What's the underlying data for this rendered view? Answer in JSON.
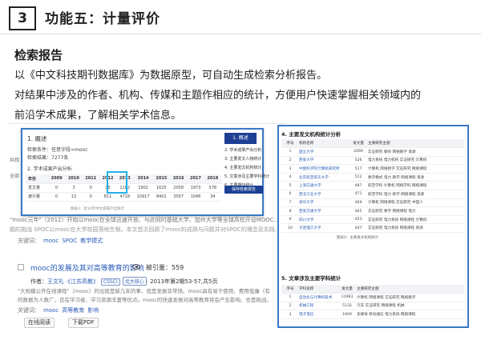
{
  "header": {
    "number": "3",
    "title": "功能五：计量评价"
  },
  "section": {
    "title": "检索报告",
    "lines": [
      "以《中文科技期刊数据库》为数据原型，可自动生成检索分析报告。",
      "对结果中涉及的作者、机构、传媒和主题作相应的统计，方便用户快速掌握相关领域内的",
      "前沿学术成果，了解相关学术信息。"
    ]
  },
  "bg_results": {
    "left_fragments": [
      "共找",
      "全部"
    ],
    "rows": [
      "\"mooc元年\"（2012）开始以mooc在全球迅速开放、与此同时基础大学、加州大学等全球高校开设MOOC...",
      "题的挑战 SPOC以mooc在大学校园落地生根。本文首次回顾了mooc的成熟与问题并对SPOC的理念及实践..."
    ],
    "keywords_label": "关键词：",
    "keywords": [
      "mooc",
      "SPOC",
      "教学模式"
    ]
  },
  "doc": {
    "title": "mooc的发展及其对高等教育的影响",
    "cited_label": "被引量：559",
    "authors_label": "作者：",
    "authors": "王文礼 ·《江苏高教》",
    "badges": [
      "CSSCI",
      "北大核心"
    ],
    "issue": "· 2013年第2期53-57,共5页",
    "abstract1": "\"大规模公开在线课程\"（mooc）的出现是新几年的事，但是发展非常快。mooc具有易于使用、费用低廉（有",
    "abstract2": "的数据为人数广，且在学习者、学习资源丰富等优点。mooc的快速发展对高等教育将会产生影响、也是挑战。",
    "keywords_label": "关键词：",
    "keywords": [
      "mooc",
      "高等教育",
      "影响"
    ],
    "read_button": "在线阅读",
    "pdf_button": "下载PDF"
  },
  "modal": {
    "overview_label": "1. 概述",
    "query_label": "检索条件：",
    "query_value": "任意字段=mooc",
    "count_label": "检索结果：",
    "count_value": "7277条",
    "side_title": "1. 概述",
    "side_items": [
      "2. 学术成果产出分析",
      "3. 主要发文人物统计",
      "4. 主要发文机构统计",
      "5. 文章涉及主要学科统计",
      "6. 主要期刊统计"
    ],
    "generate_button": "保存检索报告",
    "section2_label": "2. 学术成果产出分析",
    "years": [
      "年份",
      "2009",
      "2010",
      "2011",
      "2012",
      "2013",
      "2014",
      "2015",
      "2016",
      "2017",
      "2018"
    ],
    "rows": [
      {
        "label": "发文量",
        "values": [
          "0",
          "3",
          "0",
          "35",
          "1102",
          "1902",
          "1625",
          "2058",
          "1973",
          "578"
        ]
      },
      {
        "label": "被引量",
        "values": [
          "0",
          "13",
          "0",
          "811",
          "4718",
          "10917",
          "8401",
          "3567",
          "1046",
          "34"
        ]
      }
    ],
    "caption": "图表1：近10年中文成果产出统计"
  },
  "panel": {
    "org_title": "4. 主要发文机构统计分析",
    "org_headers": [
      "序号",
      "机构名称",
      "发文量",
      "主要研究主题"
    ],
    "org_rows": [
      [
        "1",
        "国立大学",
        "2669",
        "实证研究 教师 网络教学 资源"
      ],
      [
        "2",
        "西安大学",
        "526",
        "电力系统 电力机构 实证研究 计算机"
      ],
      [
        "3",
        "中国科学院计算机研究所",
        "517",
        "计算机 网络教学 实证研究 网络课程"
      ],
      [
        "4",
        "北京航空航天大学",
        "512",
        "教学模式 电力 教学 网络课程 资源"
      ],
      [
        "5",
        "上海交通大学",
        "487",
        "航空学科 计算机 网络学科 网络课程"
      ],
      [
        "6",
        "西北工业大学",
        "471",
        "航空学科 电力 教学 网络课程 资源"
      ],
      [
        "7",
        "清华大学",
        "469",
        "计算机 网络课程 实证研究 中国人"
      ],
      [
        "8",
        "西安交通大学",
        "465",
        "实证研究 教学 网络课程 电力"
      ],
      [
        "9",
        "四川大学",
        "453",
        "实证研究 电力系统 网络课程 计算机"
      ],
      [
        "10",
        "大连理工大学",
        "447",
        "实证研究 电力系统 网络课程 资源"
      ]
    ],
    "org_caption": "图表4：主要发文机构统计",
    "subj_title": "5. 文章涉及主要学科统计",
    "subj_headers": [
      "序号",
      "学科名称",
      "发文量",
      "主要研究主题"
    ],
    "subj_rows": [
      [
        "1",
        "自动化与计算机技术",
        "11983",
        "计算机 网络课程 实证研究 网络教学"
      ],
      [
        "2",
        "机械工程",
        "5132",
        "汽车 实证研究 网络课程 机械"
      ],
      [
        "3",
        "电子电信",
        "1609",
        "多媒体 移动通信 电力系统 网络课程"
      ]
    ]
  }
}
